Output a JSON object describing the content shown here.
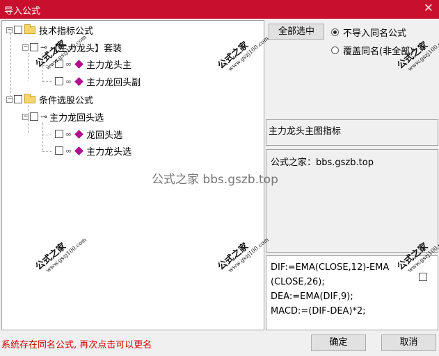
{
  "window": {
    "title": "导入公式",
    "close_glyph": "✕"
  },
  "tree": {
    "group1": {
      "label": "技术指标公式"
    },
    "suite": {
      "label": "【主力龙头】套装"
    },
    "item1": {
      "label": "主力龙头主"
    },
    "item2": {
      "label": "主力龙回头副"
    },
    "group2": {
      "label": "条件选股公式"
    },
    "subgroup": {
      "label": "主力龙回头选"
    },
    "item3": {
      "label": "龙回头选"
    },
    "item4": {
      "label": "主力龙头选"
    }
  },
  "right": {
    "select_all_label": "全部选中",
    "radio1_label": "不导入同名公式",
    "radio2_label": "覆盖同名(非全部)",
    "description": "主力龙头主图指标",
    "source_text": "公式之家：bbs.gszb.top",
    "formula_lines": [
      "DIF:=EMA(CLOSE,12)-EMA",
      "(CLOSE,26);",
      "DEA:=EMA(DIF,9);",
      "MACD:=(DIF-DEA)*2;"
    ]
  },
  "watermark": {
    "big": "公式之家 bbs.gszb.top",
    "stamp_title": "公式之家",
    "stamp_url": "www.gszj100.com"
  },
  "status": {
    "message": "系统存在同名公式, 再次点击可以更名"
  },
  "buttons": {
    "ok": "确定",
    "cancel": "取消"
  },
  "colors": {
    "titlebar": "#c8102e",
    "status_text": "#d00000"
  }
}
